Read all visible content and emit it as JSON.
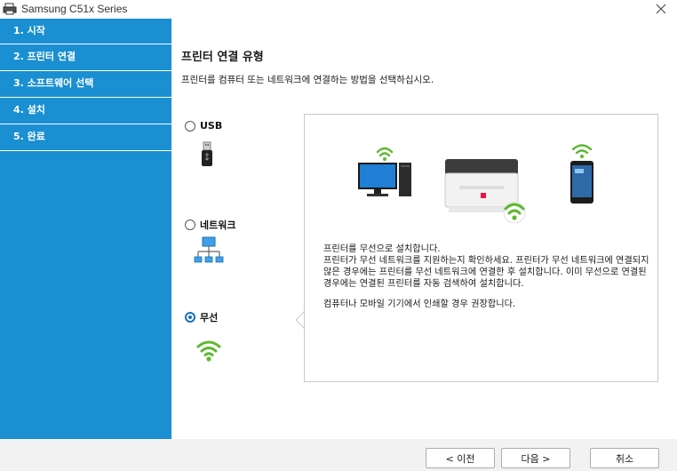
{
  "window": {
    "title": "Samsung C51x Series",
    "close_icon": "close-icon"
  },
  "sidebar": {
    "steps": [
      {
        "label": "1. 시작"
      },
      {
        "label": "2. 프린터 연결"
      },
      {
        "label": "3. 소프트웨어 선택"
      },
      {
        "label": "4. 설치"
      },
      {
        "label": "5. 완료"
      }
    ],
    "active_index": 1
  },
  "main": {
    "title": "프린터 연결 유형",
    "description": "프린터를 컴퓨터 또는 네트워크에 연결하는 방법을 선택하십시오.",
    "options": [
      {
        "label": "USB",
        "selected": false,
        "icon": "usb-icon"
      },
      {
        "label": "네트워크",
        "selected": false,
        "icon": "network-icon"
      },
      {
        "label": "무선",
        "selected": true,
        "icon": "wifi-icon"
      }
    ],
    "info": {
      "line1": "프린터를 무선으로 설치합니다.",
      "line2": "프린터가 무선 네트워크를 지원하는지 확인하세요.  프린터가 무선 네트워크에 연결되지 않은 경우에는 프린터를 무선 네트워크에 연결한 후 설치합니다. 이미 무선으로 연결된 경우에는 연결된 프린터를 자동 검색하여 설치합니다.",
      "line3": "컴퓨터나 모바일 기기에서 인쇄할 경우 권장합니다."
    }
  },
  "footer": {
    "back_label": "< 이전",
    "next_label": "다음 >",
    "cancel_label": "취소"
  },
  "colors": {
    "sidebar": "#1a8fd1",
    "wifi_green": "#5cb82e",
    "radio_blue": "#1570c8"
  }
}
